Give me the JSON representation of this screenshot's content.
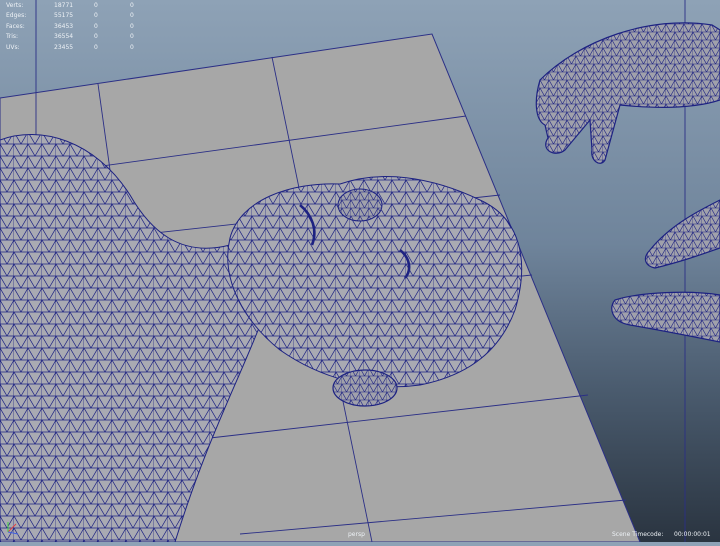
{
  "hud": {
    "rows": [
      {
        "label": "Verts:",
        "value": "18771",
        "selected": "0",
        "uv": "0"
      },
      {
        "label": "Edges:",
        "value": "55175",
        "selected": "0",
        "uv": "0"
      },
      {
        "label": "Faces:",
        "value": "36453",
        "selected": "0",
        "uv": "0"
      },
      {
        "label": "Tris:",
        "value": "36554",
        "selected": "0",
        "uv": "0"
      },
      {
        "label": "UVs:",
        "value": "23455",
        "selected": "0",
        "uv": "0"
      }
    ]
  },
  "viewport": {
    "camera": "persp",
    "timecode_label": "Scene Timecode:",
    "timecode_value": "00:00:00:01"
  },
  "colors": {
    "plane": "#a7a7a7",
    "grid_line": "#2b2f86",
    "mesh_fill": "#a9aab2",
    "mesh_wire": "#1d2282",
    "hud_text": "#eef2f6"
  }
}
